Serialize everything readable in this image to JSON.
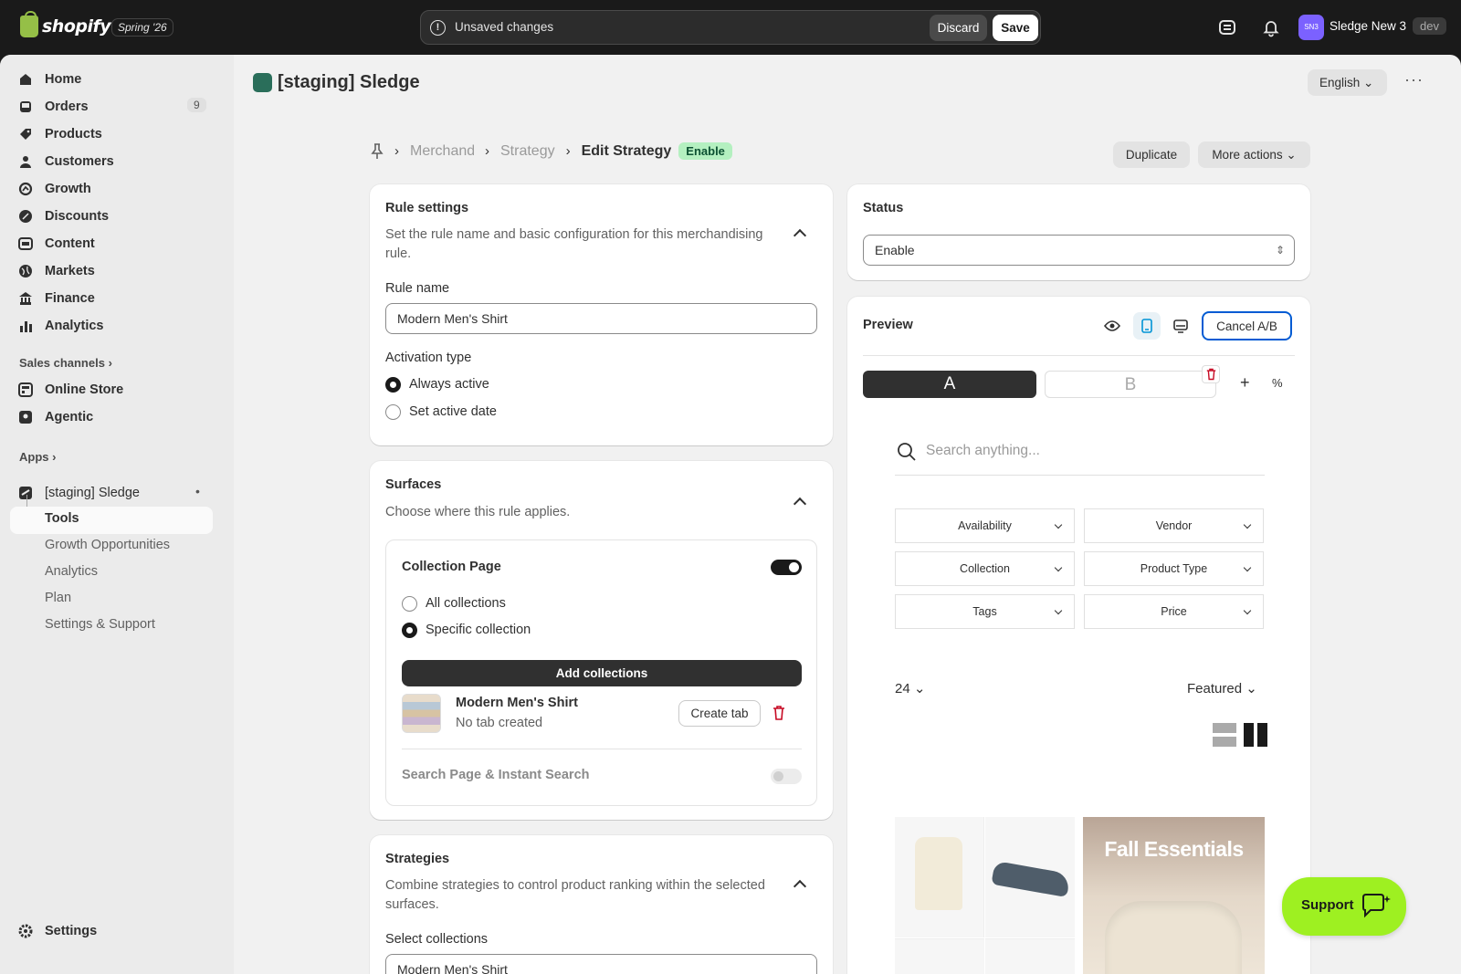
{
  "topbar": {
    "logo_text": "shopify",
    "edition": "Spring '26",
    "unsaved_text": "Unsaved changes",
    "discard": "Discard",
    "save": "Save",
    "avatar": "SN3",
    "store_name": "Sledge New 3",
    "env": "dev"
  },
  "sidebar": {
    "items": [
      {
        "label": "Home",
        "icon": "home-icon"
      },
      {
        "label": "Orders",
        "icon": "inbox-icon",
        "badge": "9"
      },
      {
        "label": "Products",
        "icon": "tag-icon"
      },
      {
        "label": "Customers",
        "icon": "person-icon"
      },
      {
        "label": "Growth",
        "icon": "growth-icon"
      },
      {
        "label": "Discounts",
        "icon": "discount-icon"
      },
      {
        "label": "Content",
        "icon": "content-icon"
      },
      {
        "label": "Markets",
        "icon": "globe-icon"
      },
      {
        "label": "Finance",
        "icon": "bank-icon"
      },
      {
        "label": "Analytics",
        "icon": "bar-chart-icon"
      }
    ],
    "sales_channels": "Sales channels",
    "channels": [
      {
        "label": "Online Store",
        "icon": "store-icon"
      },
      {
        "label": "Agentic",
        "icon": "agent-icon"
      }
    ],
    "apps": "Apps",
    "app_name": "[staging] Sledge",
    "app_sub": [
      "Tools",
      "Growth Opportunities",
      "Analytics",
      "Plan",
      "Settings & Support"
    ],
    "settings": "Settings"
  },
  "header": {
    "app_title": "[staging] Sledge",
    "language": "English"
  },
  "breadcrumb": {
    "items": [
      "Merchandising",
      "Strategy"
    ],
    "current": "Edit Strategy",
    "badge": "Enable"
  },
  "actions": {
    "duplicate": "Duplicate",
    "more": "More actions"
  },
  "rule_settings": {
    "title": "Rule settings",
    "desc": "Set the rule name and basic configuration for this merchandising rule.",
    "name_label": "Rule name",
    "name_value": "Modern Men's Shirt",
    "activation_label": "Activation type",
    "options": [
      "Always active",
      "Set active date"
    ]
  },
  "surfaces": {
    "title": "Surfaces",
    "desc": "Choose where this rule applies.",
    "collection_page": "Collection Page",
    "options": [
      "All collections",
      "Specific collection"
    ],
    "add_button": "Add collections",
    "item_name": "Modern Men's Shirt",
    "item_status": "No tab created",
    "create_tab": "Create tab",
    "search_page": "Search Page & Instant Search"
  },
  "strategies": {
    "title": "Strategies",
    "desc": "Combine strategies to control product ranking within the selected surfaces.",
    "select_label": "Select collections",
    "select_value": "Modern Men's Shirt"
  },
  "status": {
    "title": "Status",
    "value": "Enable"
  },
  "preview": {
    "title": "Preview",
    "cancel_ab": "Cancel A/B",
    "variant_a": "A",
    "variant_b": "B",
    "search_placeholder": "Search anything...",
    "filters": [
      "Availability",
      "Vendor",
      "Collection",
      "Product Type",
      "Tags",
      "Price"
    ],
    "per_page": "24",
    "sort": "Featured",
    "promo": "Fall Essentials"
  },
  "support": "Support"
}
